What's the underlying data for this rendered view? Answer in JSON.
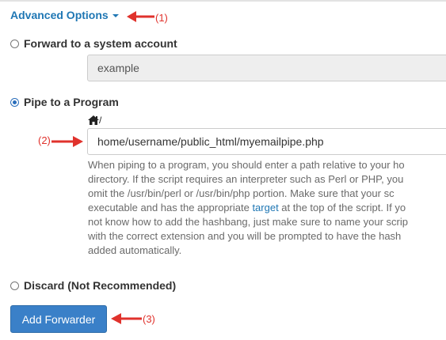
{
  "advanced_options": {
    "label": "Advanced Options"
  },
  "forward_system_account": {
    "label": "Forward to a system account",
    "selected": false,
    "value": "example"
  },
  "pipe_to_program": {
    "label": "Pipe to a Program",
    "selected": true,
    "path_prefix": "/",
    "value": "home/username/public_html/myemailpipe.php",
    "help_lines": [
      "When piping to a program, you should enter a path relative to your ho",
      "directory. If the script requires an interpreter such as Perl or PHP, you",
      "omit the /usr/bin/perl or /usr/bin/php portion. Make sure that your sc",
      "executable and has the appropriate ",
      "target",
      " at the top of the script. If yo",
      "not know how to add the hashbang, just make sure to name your scrip",
      "with the correct extension and you will be prompted to have the hash",
      "added automatically."
    ]
  },
  "discard": {
    "label": "Discard (Not Recommended)",
    "selected": false
  },
  "add_forwarder_button": {
    "label": "Add Forwarder"
  },
  "annotations": {
    "one": "(1)",
    "two": "(2)",
    "three": "(3)"
  },
  "colors": {
    "link": "#1f77b4",
    "button": "#3a80c8",
    "annotation": "#e0322c"
  },
  "icons": {
    "home": "home-icon",
    "caret": "caret-down-icon",
    "arrow": "red-arrow-icon"
  }
}
